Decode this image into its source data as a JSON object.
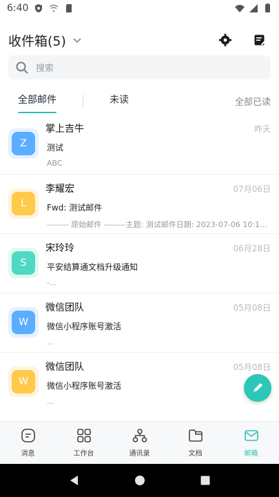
{
  "status_bar": {
    "time": "6:40"
  },
  "header": {
    "title": "收件箱(5)"
  },
  "search": {
    "placeholder": "搜索"
  },
  "tabs": {
    "all": "全部邮件",
    "unread": "未读",
    "mark_all_read": "全部已读"
  },
  "emails": [
    {
      "sender": "掌上吉牛",
      "date": "昨天",
      "subject": "测试",
      "preview": "ABC",
      "initial": "Z",
      "avatar_color": "#5aaeff",
      "avatar_bg": "#e4f1ff"
    },
    {
      "sender": "李耀宏",
      "date": "07月06日",
      "subject": "Fwd: 测试邮件",
      "preview": "-------- 原始邮件 --------主题: 测试邮件日期: 2023-07-06 10:10...",
      "initial": "L",
      "avatar_color": "#ffc94a",
      "avatar_bg": "#fff4dc"
    },
    {
      "sender": "宋玲玲",
      "date": "06月28日",
      "subject": "平安结算通文档升级通知",
      "preview": "-...",
      "initial": "S",
      "avatar_color": "#4fd8c2",
      "avatar_bg": "#e1f8f3"
    },
    {
      "sender": "微信团队",
      "date": "05月08日",
      "subject": "微信小程序账号激活",
      "preview": "...",
      "initial": "W",
      "avatar_color": "#5aaeff",
      "avatar_bg": "#e4f1ff"
    },
    {
      "sender": "微信团队",
      "date": "05月08日",
      "subject": "微信小程序账号激活",
      "preview": "...",
      "initial": "W",
      "avatar_color": "#ffc94a",
      "avatar_bg": "#fff4dc"
    }
  ],
  "bottom_nav": [
    {
      "label": "消息",
      "icon": "message-icon"
    },
    {
      "label": "工作台",
      "icon": "grid-icon"
    },
    {
      "label": "通讯录",
      "icon": "org-chart-icon"
    },
    {
      "label": "文档",
      "icon": "folder-icon"
    },
    {
      "label": "邮箱",
      "icon": "mail-icon"
    }
  ],
  "colors": {
    "accent": "#28c2b3",
    "fab": "#2dc7b7"
  }
}
